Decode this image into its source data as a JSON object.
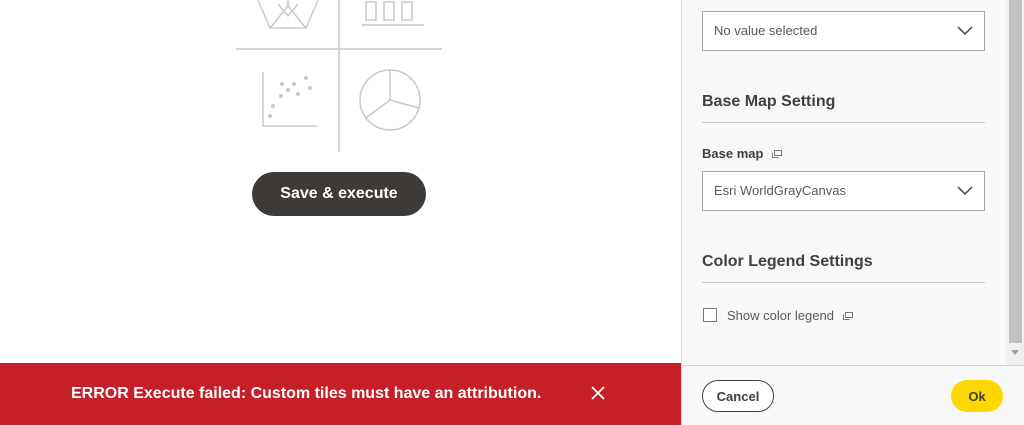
{
  "main": {
    "save_button_label": "Save & execute",
    "chart_type_icons": [
      "radar-chart-icon",
      "bar-chart-icon",
      "scatter-chart-icon",
      "pie-chart-icon"
    ]
  },
  "toast": {
    "message": "ERROR Execute failed: Custom tiles must have an attribution.",
    "close_icon": "close-icon",
    "color": "#c5202a"
  },
  "panel": {
    "top_select": {
      "value": "No value selected"
    },
    "base_map_section": {
      "title": "Base Map Setting",
      "base_map_label": "Base map",
      "base_map_value": "Esri WorldGrayCanvas"
    },
    "color_legend_section": {
      "title": "Color Legend Settings",
      "show_color_legend_label": "Show color legend",
      "show_color_legend_checked": false
    },
    "footer": {
      "cancel_label": "Cancel",
      "ok_label": "Ok",
      "ok_color": "#ffd700"
    }
  }
}
